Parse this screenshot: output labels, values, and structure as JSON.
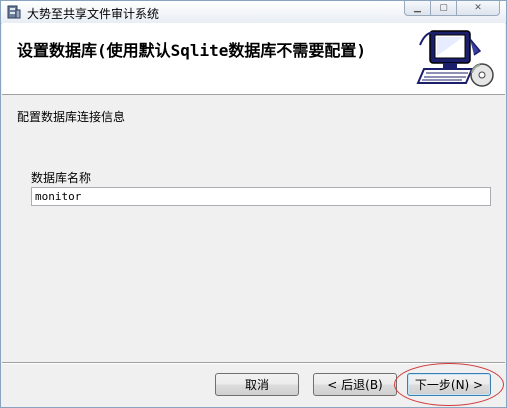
{
  "window": {
    "title": "大势至共享文件审计系统"
  },
  "header": {
    "title": "设置数据库(使用默认Sqlite数据库不需要配置)",
    "art_icon": "computer-cd-icon"
  },
  "section": {
    "label": "配置数据库连接信息"
  },
  "form": {
    "db_name_label": "数据库名称",
    "db_name_value": "monitor"
  },
  "buttons": {
    "cancel": "取消",
    "back": "< 后退(B)",
    "next": "下一步(N) >"
  },
  "colors": {
    "highlight_circle": "#d23a3a",
    "primary_border": "#3c7fb1"
  }
}
